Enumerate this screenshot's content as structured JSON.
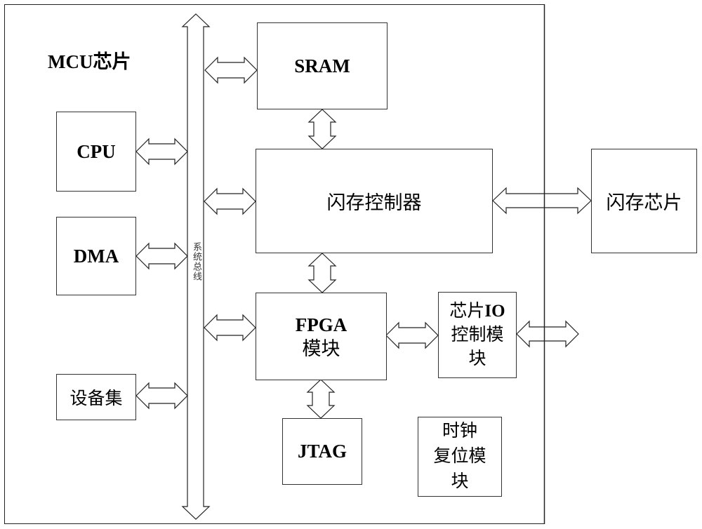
{
  "mcu": {
    "title": "MCU芯片"
  },
  "bus": {
    "label": "系统总线"
  },
  "blocks": {
    "cpu": {
      "label": "CPU"
    },
    "dma": {
      "label": "DMA"
    },
    "device_set": {
      "label": "设备集"
    },
    "sram": {
      "label": "SRAM"
    },
    "flash_controller": {
      "label": "闪存控制器"
    },
    "fpga": {
      "line1": "FPGA",
      "line2": "模块"
    },
    "chip_io": {
      "line1_cn": "芯片",
      "line1_en": "IO",
      "line2": "控制模",
      "line3": "块"
    },
    "jtag": {
      "label": "JTAG"
    },
    "clock_reset": {
      "line1": "时钟",
      "line2": "复位模",
      "line3": "块"
    },
    "flash_chip": {
      "label": "闪存芯片"
    }
  },
  "connections": [
    {
      "from": "cpu",
      "to": "system-bus",
      "type": "bidirectional"
    },
    {
      "from": "dma",
      "to": "system-bus",
      "type": "bidirectional"
    },
    {
      "from": "device_set",
      "to": "system-bus",
      "type": "bidirectional"
    },
    {
      "from": "system-bus",
      "to": "sram",
      "type": "bidirectional"
    },
    {
      "from": "system-bus",
      "to": "flash_controller",
      "type": "bidirectional"
    },
    {
      "from": "system-bus",
      "to": "fpga",
      "type": "bidirectional"
    },
    {
      "from": "sram",
      "to": "flash_controller",
      "type": "bidirectional"
    },
    {
      "from": "flash_controller",
      "to": "fpga",
      "type": "bidirectional"
    },
    {
      "from": "fpga",
      "to": "chip_io",
      "type": "bidirectional"
    },
    {
      "from": "fpga",
      "to": "jtag",
      "type": "bidirectional"
    },
    {
      "from": "flash_controller",
      "to": "flash_chip",
      "type": "bidirectional"
    },
    {
      "from": "chip_io",
      "to": "external",
      "type": "bidirectional"
    }
  ]
}
